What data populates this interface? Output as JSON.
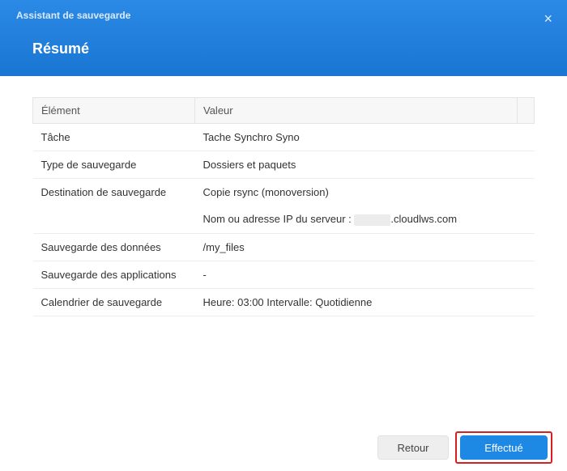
{
  "header": {
    "title": "Assistant de sauvegarde",
    "subtitle": "Résumé",
    "close_label": "×"
  },
  "table": {
    "col_element": "Élément",
    "col_value": "Valeur",
    "rows": {
      "task": {
        "label": "Tâche",
        "value": "Tache Synchro Syno"
      },
      "type": {
        "label": "Type de sauvegarde",
        "value": "Dossiers et paquets"
      },
      "dest": {
        "label": "Destination de sauvegarde",
        "line1": "Copie rsync (monoversion)",
        "line2_prefix": "Nom ou adresse IP du serveur : ",
        "line2_suffix": ".cloudlws.com"
      },
      "data": {
        "label": "Sauvegarde des données",
        "value": "/my_files"
      },
      "apps": {
        "label": "Sauvegarde des applications",
        "value": "-"
      },
      "schedule": {
        "label": "Calendrier de sauvegarde",
        "value": "Heure: 03:00 Intervalle: Quotidienne"
      }
    }
  },
  "footer": {
    "back_label": "Retour",
    "done_label": "Effectué"
  }
}
